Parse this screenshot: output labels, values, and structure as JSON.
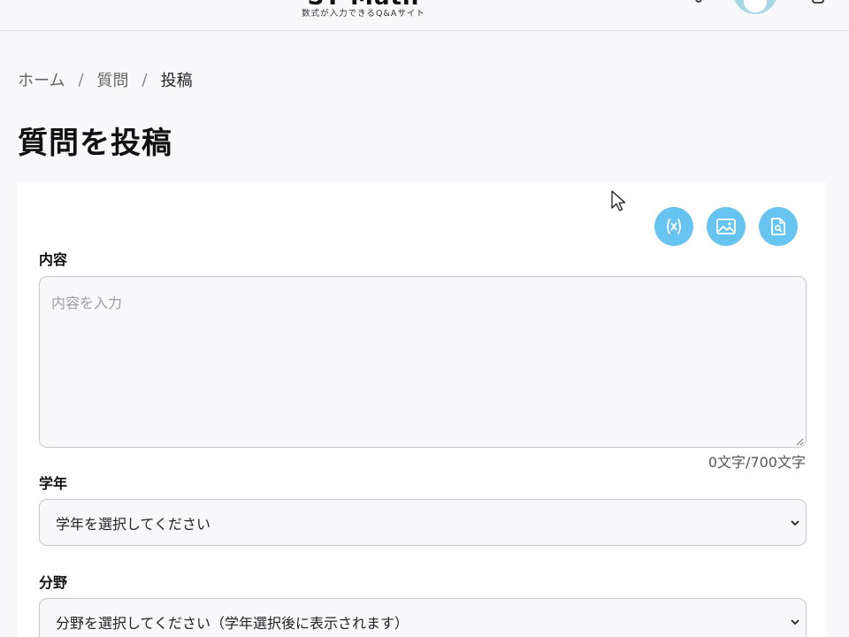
{
  "header": {
    "logo_text": "ST Math",
    "logo_subtitle": "数式が入力できるQ&Aサイト"
  },
  "breadcrumb": {
    "items": [
      "ホーム",
      "質問",
      "投稿"
    ],
    "separator": "/"
  },
  "page": {
    "title": "質問を投稿"
  },
  "toolbar": {
    "formula_icon": "formula-icon",
    "image_icon": "image-icon",
    "preview_icon": "document-search-icon",
    "button_color": "#67c3f0"
  },
  "form": {
    "content_label": "内容",
    "content_placeholder": "内容を入力",
    "content_value": "",
    "char_count": "0文字/700文字",
    "grade_label": "学年",
    "grade_selected": "学年を選択してください",
    "subject_label": "分野",
    "subject_selected": "分野を選択してください（学年選択後に表示されます）"
  }
}
